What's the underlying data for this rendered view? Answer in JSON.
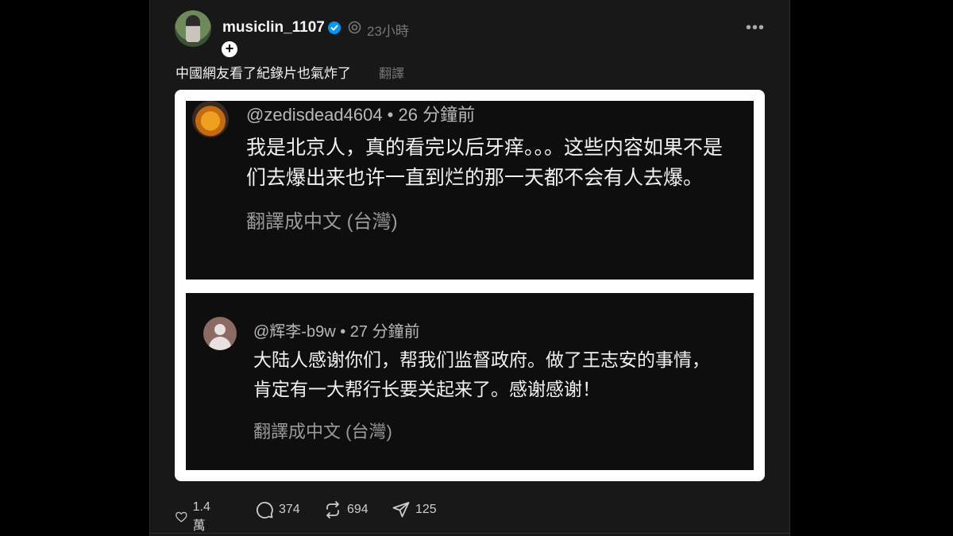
{
  "post": {
    "username": "musiclin_1107",
    "timestamp": "23小時",
    "caption": "中國網友看了紀錄片也氣炸了",
    "translate_label": "翻譯"
  },
  "comments": [
    {
      "handle": "@zedisdead4604 • 26 分鐘前",
      "lines": [
        "我是北京人，真的看完以后牙痒。。。这些内容如果不是",
        "们去爆出来也许一直到烂的那一天都不会有人去爆。"
      ],
      "translate": "翻譯成中文 (台灣)"
    },
    {
      "handle": "@辉李-b9w • 27 分鐘前",
      "lines": [
        "大陆人感谢你们，帮我们监督政府。做了王志安的事情，",
        "肯定有一大帮行长要关起来了。感谢感谢！"
      ],
      "translate": "翻譯成中文 (台灣)"
    }
  ],
  "actions": {
    "like_count": "1.4 萬",
    "comment_count": "374",
    "repost_count": "694",
    "share_count": "125"
  },
  "icons": {
    "like": "heart-icon",
    "comment": "comment-bubble-icon",
    "repost": "repost-icon",
    "share": "send-icon",
    "verified": "verified-badge-icon",
    "more": "more-dots-icon"
  },
  "colors": {
    "background": "#000000",
    "card": "#181818",
    "verified": "#0095f6",
    "muted": "#777777"
  }
}
